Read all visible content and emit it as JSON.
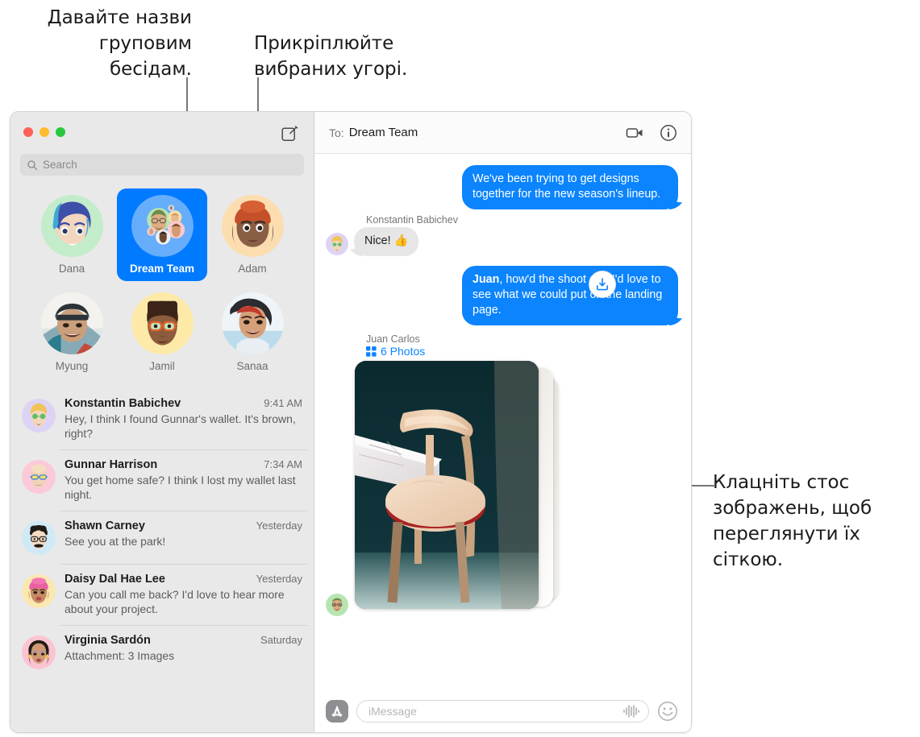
{
  "callouts": {
    "group_names": "Давайте назви\nгруповим\nбесідам.",
    "pin_top": "Прикріплюйте\nвибраних угорі.",
    "photo_stack": "Клацніть стос\nзображень, щоб\nпереглянути їх\nсіткою."
  },
  "window": {
    "traffic_lights": [
      "close",
      "minimize",
      "zoom"
    ],
    "compose_icon": "compose-icon"
  },
  "search": {
    "placeholder": "Search",
    "value": "",
    "icon": "search-icon"
  },
  "pinned": [
    {
      "name": "Dana",
      "selected": false,
      "icon": "memoji-dana"
    },
    {
      "name": "Dream Team",
      "selected": true,
      "icon": "group-avatar-dream-team"
    },
    {
      "name": "Adam",
      "selected": false,
      "icon": "memoji-adam"
    },
    {
      "name": "Myung",
      "selected": false,
      "icon": "photo-myung"
    },
    {
      "name": "Jamil",
      "selected": false,
      "icon": "memoji-jamil"
    },
    {
      "name": "Sanaa",
      "selected": false,
      "icon": "photo-sanaa"
    }
  ],
  "conversations": [
    {
      "name": "Konstantin Babichev",
      "time": "9:41 AM",
      "preview": "Hey, I think I found Gunnar's wallet. It's brown, right?"
    },
    {
      "name": "Gunnar Harrison",
      "time": "7:34 AM",
      "preview": "You get home safe? I think I lost my wallet last night."
    },
    {
      "name": "Shawn Carney",
      "time": "Yesterday",
      "preview": "See you at the park!"
    },
    {
      "name": "Daisy Dal Hae Lee",
      "time": "Yesterday",
      "preview": "Can you call me back? I'd love to hear more about your project."
    },
    {
      "name": "Virginia Sardón",
      "time": "Saturday",
      "preview": "Attachment: 3 Images"
    }
  ],
  "chat_header": {
    "to_label": "To:",
    "recipient": "Dream Team",
    "facetime_icon": "video-camera-icon",
    "info_icon": "info-circle-icon"
  },
  "messages": [
    {
      "direction": "outgoing",
      "text": "We've been trying to get designs together for the new season's lineup."
    },
    {
      "direction": "incoming",
      "sender": "Konstantin Babichev",
      "text": "Nice!  👍"
    },
    {
      "direction": "outgoing",
      "bold_prefix": "Juan",
      "text": ", how'd the shoot go? I'd love to see what we could put on the landing page."
    },
    {
      "direction": "incoming",
      "sender": "Juan Carlos",
      "attachment_count": "6 Photos",
      "attachment_icon": "grid-icon",
      "save_icon": "save-download-icon"
    }
  ],
  "composer": {
    "apps_icon": "app-store-icon",
    "placeholder": "iMessage",
    "value": "",
    "audio_icon": "audio-waveform-icon",
    "emoji_icon": "smiley-face-icon"
  },
  "colors": {
    "accent_blue": "#0b84fe",
    "bubble_gray": "#e6e6e6",
    "sidebar_bg": "#e9e9e9",
    "selected_pin": "#007aff"
  }
}
